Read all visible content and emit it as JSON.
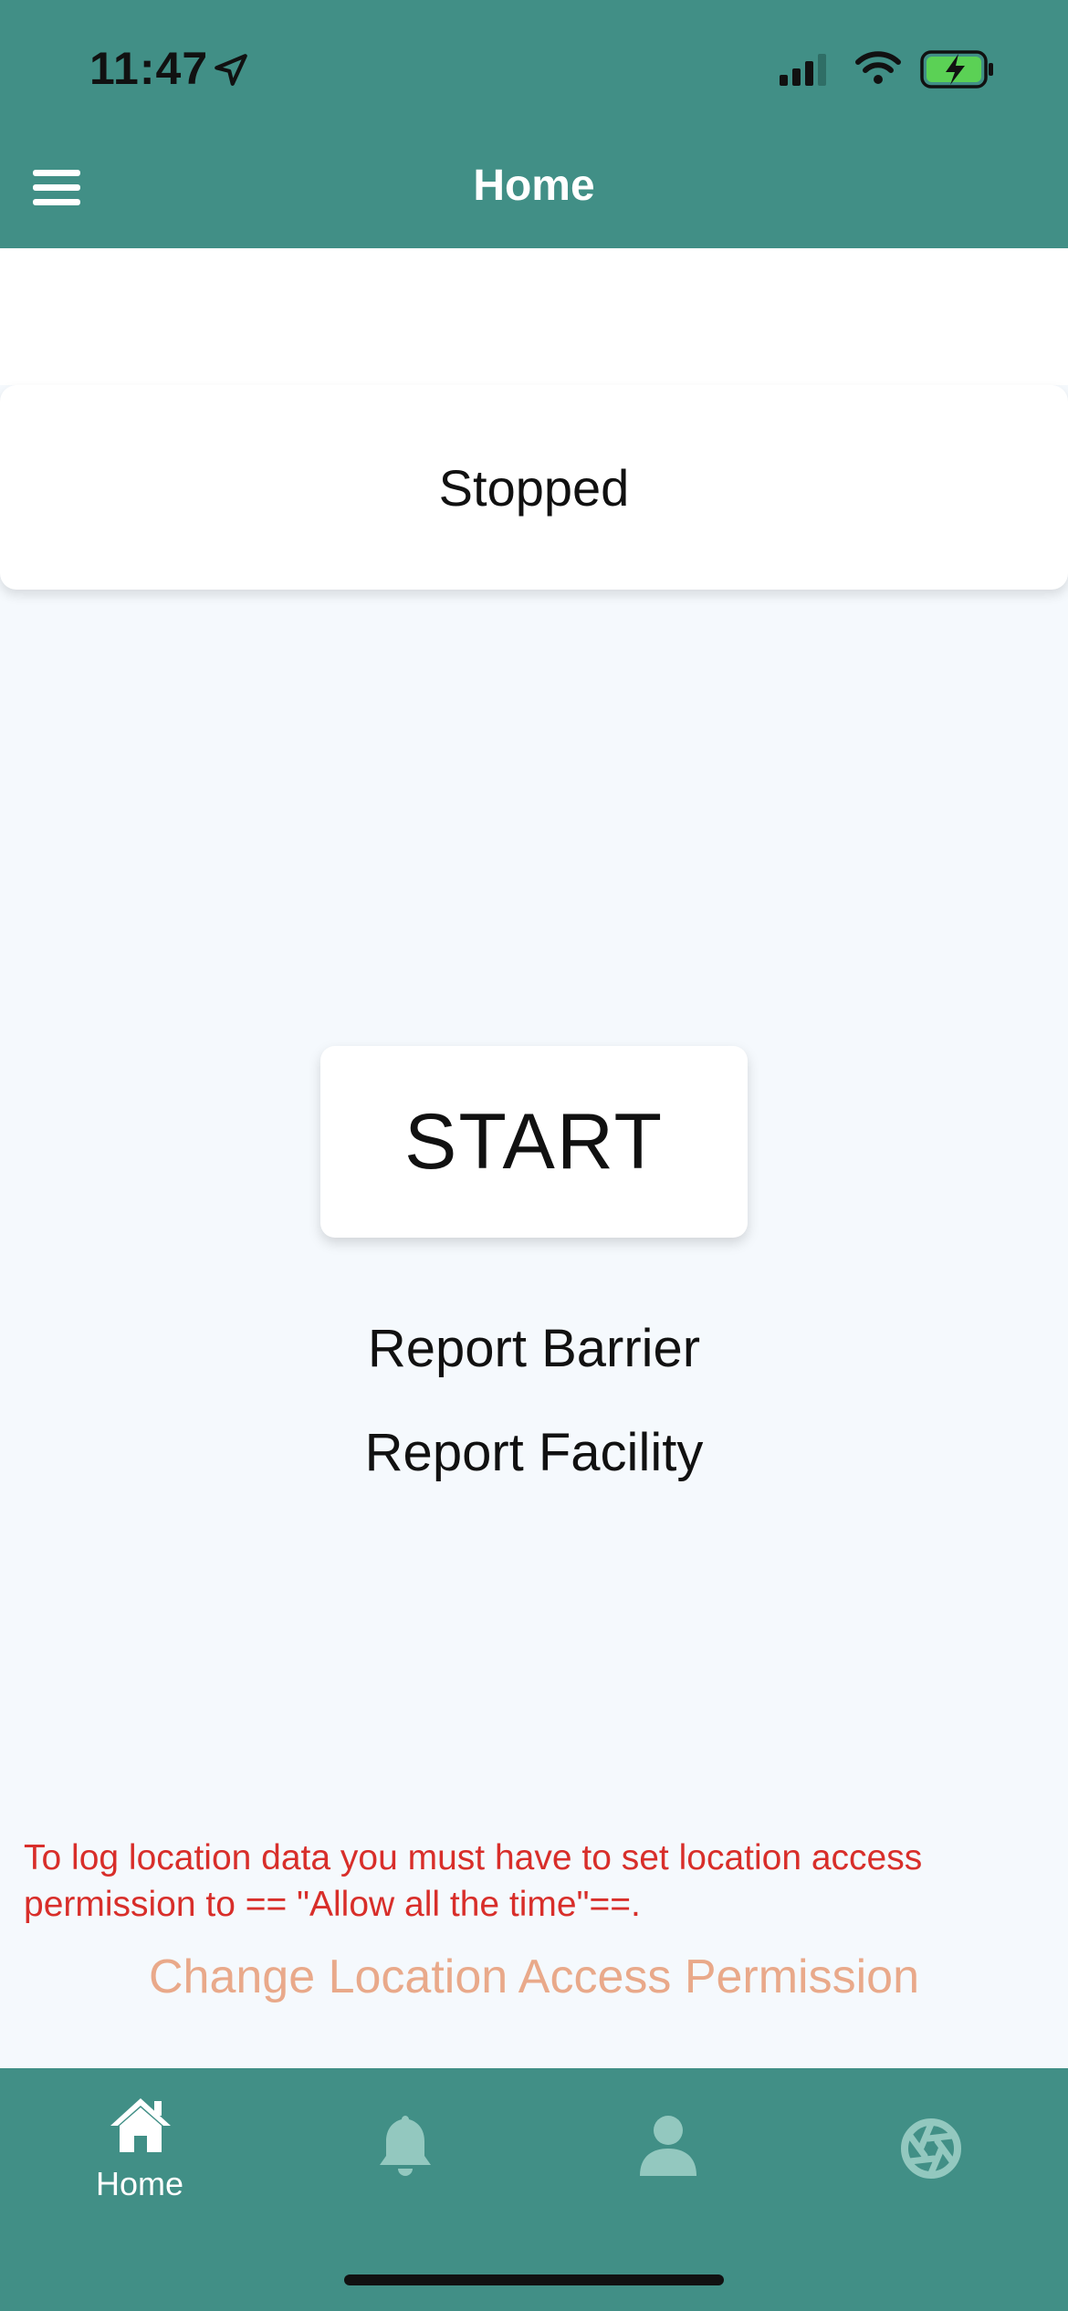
{
  "status_bar": {
    "time": "11:47"
  },
  "header": {
    "title": "Home"
  },
  "tracking": {
    "status": "Stopped",
    "start_label": "START"
  },
  "links": {
    "report_barrier": "Report Barrier",
    "report_facility": "Report Facility"
  },
  "permission": {
    "warning": "To log location data you must have to set location access permission to == \"Allow all the time\"==.",
    "change_label": "Change Location Access Permission"
  },
  "tabs": [
    {
      "label": "Home",
      "icon": "home-icon",
      "active": true
    },
    {
      "label": "",
      "icon": "bell-icon",
      "active": false
    },
    {
      "label": "",
      "icon": "person-icon",
      "active": false
    },
    {
      "label": "",
      "icon": "aperture-icon",
      "active": false
    }
  ],
  "colors": {
    "primary": "#418f86",
    "background": "#f5f9fd",
    "warning": "#d82e2a",
    "link_accent": "#e9a98a",
    "inactive_icon": "#93c8bf"
  }
}
